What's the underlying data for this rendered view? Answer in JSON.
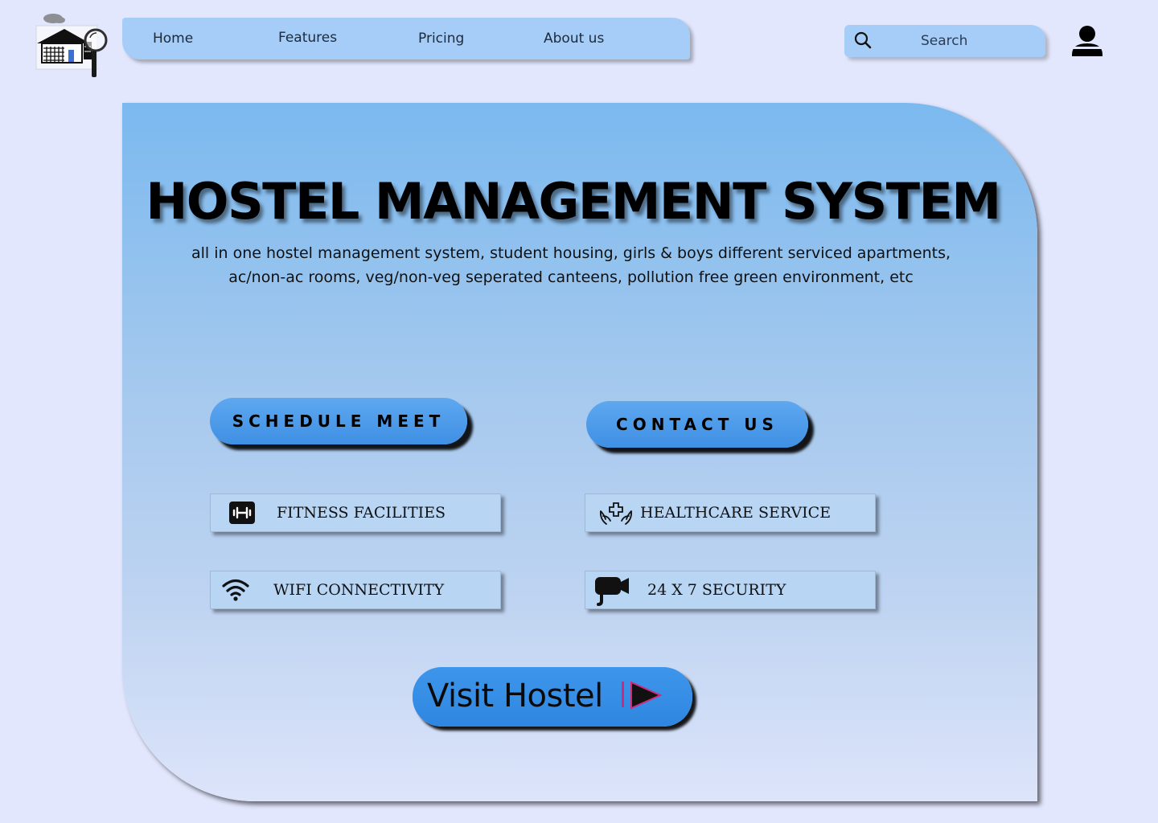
{
  "nav": {
    "items": [
      "Home",
      "Features",
      "Pricing",
      "About us"
    ]
  },
  "search": {
    "placeholder": "Search"
  },
  "hero": {
    "title": "HOSTEL MANAGEMENT SYSTEM",
    "subtitle": "all in one hostel management system, student housing, girls & boys different serviced apartments, ac/non-ac rooms, veg/non-veg seperated canteens, pollution free green environment, etc"
  },
  "buttons": {
    "schedule": "SCHEDULE MEET",
    "contact": "CONTACT US",
    "visit": "Visit Hostel"
  },
  "features": {
    "fitness": "FITNESS  FACILITIES",
    "healthcare": "HEALTHCARE  SERVICE",
    "wifi": "WIFI  CONNECTIVITY",
    "security": "24 X 7 SECURITY"
  },
  "icons": {
    "logo": "hostel-search-logo",
    "search": "magnifier",
    "user": "person",
    "fitness": "dumbbell",
    "healthcare": "hands-cross",
    "wifi": "wifi",
    "security": "cctv-camera",
    "visit": "play-arrow"
  },
  "colors": {
    "page_background": "#e2e7fd",
    "nav_background": "#a6cdf7",
    "hero_top": "#7bb9ef",
    "hero_bottom": "#dde4fa",
    "button_blue": "#3f8fe4",
    "feature_card": "#b8d5f3",
    "play_accent": "#d0287a"
  }
}
